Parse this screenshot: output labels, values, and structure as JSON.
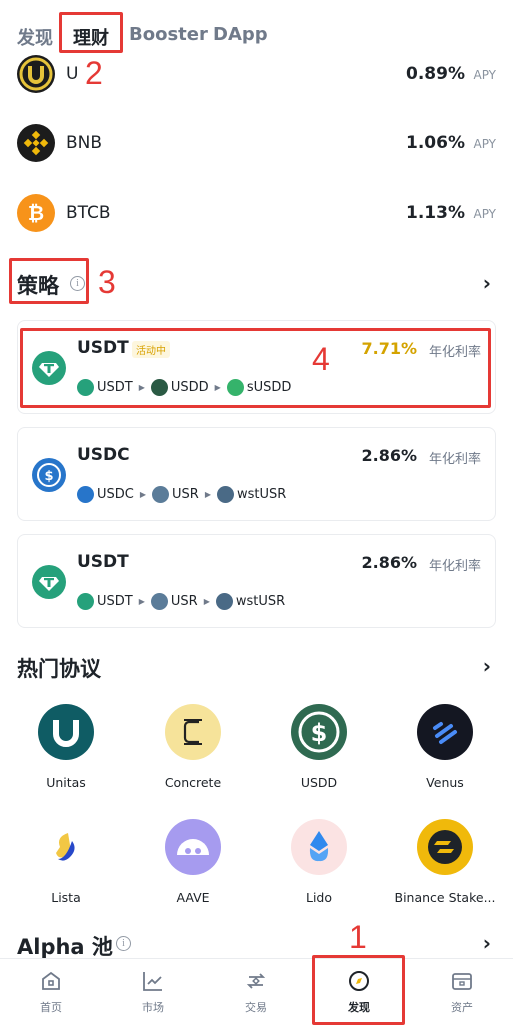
{
  "top_tabs": [
    "发现",
    "理财",
    "Booster",
    "DApp"
  ],
  "annotations": {
    "a1": "1",
    "a2": "2",
    "a3": "3",
    "a4": "4"
  },
  "assets": [
    {
      "name": "U",
      "rate": "0.89%",
      "unit": "APY",
      "icon": "u-coin-icon"
    },
    {
      "name": "BNB",
      "rate": "1.06%",
      "unit": "APY",
      "icon": "bnb-coin-icon"
    },
    {
      "name": "BTCB",
      "rate": "1.13%",
      "unit": "APY",
      "icon": "btcb-coin-icon"
    }
  ],
  "strategy": {
    "title": "策略",
    "cards": [
      {
        "title": "USDT",
        "badge": "活动中",
        "rate": "7.71%",
        "rate_label": "年化利率",
        "path": [
          "USDT",
          "USDD",
          "sUSDD"
        ]
      },
      {
        "title": "USDC",
        "badge": "",
        "rate": "2.86%",
        "rate_label": "年化利率",
        "path": [
          "USDC",
          "USR",
          "wstUSR"
        ]
      },
      {
        "title": "USDT",
        "badge": "",
        "rate": "2.86%",
        "rate_label": "年化利率",
        "path": [
          "USDT",
          "USR",
          "wstUSR"
        ]
      }
    ]
  },
  "protocols": {
    "title": "热门协议",
    "items": [
      "Unitas",
      "Concrete",
      "USDD",
      "Venus",
      "Lista",
      "AAVE",
      "Lido",
      "Binance Stake..."
    ]
  },
  "alpha": {
    "title": "Alpha 池"
  },
  "bottom_nav": [
    "首页",
    "市场",
    "交易",
    "发现",
    "资产"
  ],
  "colors": {
    "accent_gold": "#d4a300",
    "annotation_red": "#e53935",
    "text": "#1e2329",
    "muted": "#707a8a"
  }
}
